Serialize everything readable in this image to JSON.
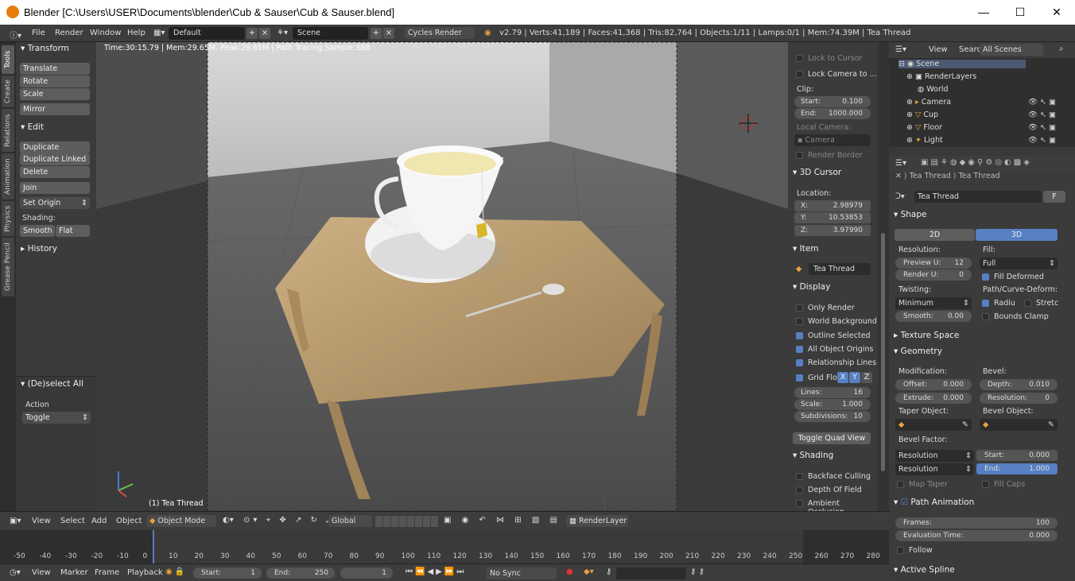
{
  "window": {
    "title": "Blender [C:\\Users\\USER\\Documents\\blender\\Cub & Sauser\\Cub & Sauser.blend]",
    "min": "—",
    "max": "☐",
    "close": "✕"
  },
  "info": {
    "menus": [
      "File",
      "Render",
      "Window",
      "Help"
    ],
    "layout": "Default",
    "scene": "Scene",
    "engine": "Cycles Render",
    "stats": "v2.79 | Verts:41,189 | Faces:41,368 | Tris:82,764 | Objects:1/11 | Lamps:0/1 | Mem:74.39M | Tea Thread"
  },
  "tabs": [
    "Tools",
    "Create",
    "Relations",
    "Animation",
    "Physics",
    "Grease Pencil"
  ],
  "toolshelf": {
    "transform": "Transform",
    "translate": "Translate",
    "rotate": "Rotate",
    "scale": "Scale",
    "mirror": "Mirror",
    "edit": "Edit",
    "duplicate": "Duplicate",
    "duplicate_linked": "Duplicate Linked",
    "delete": "Delete",
    "join": "Join",
    "set_origin": "Set Origin",
    "shading": "Shading:",
    "smooth": "Smooth",
    "flat": "Flat",
    "history": "History",
    "deselect": "(De)select All",
    "action": "Action",
    "toggle": "Toggle"
  },
  "viewport": {
    "status": "Time:30:15.79 | Mem:29.65M, Peak:29.65M | Path Tracing Sample 388",
    "object": "(1) Tea Thread"
  },
  "npanel": {
    "lock_cursor": "Lock to Cursor",
    "lock_camera": "Lock Camera to ...",
    "clip": "Clip:",
    "start_l": "Start:",
    "start_v": "0.100",
    "end_l": "End:",
    "end_v": "1000.000",
    "local_camera": "Local Camera:",
    "camera": "Camera",
    "render_border": "Render Border",
    "cursor": "3D Cursor",
    "location": "Location:",
    "x_l": "X:",
    "x_v": "2.98979",
    "y_l": "Y:",
    "y_v": "10.53853",
    "z_l": "Z:",
    "z_v": "3.97990",
    "item": "Item",
    "item_name": "Tea Thread",
    "display": "Display",
    "only_render": "Only Render",
    "world_bg": "World Background",
    "outline": "Outline Selected",
    "all_origins": "All Object Origins",
    "rel_lines": "Relationship Lines",
    "grid_floor": "Grid Flo",
    "gx": "X",
    "gy": "Y",
    "gz": "Z",
    "lines_l": "Lines:",
    "lines_v": "16",
    "scale_l": "Scale:",
    "scale_v": "1.000",
    "subdiv_l": "Subdivisions:",
    "subdiv_v": "10",
    "quad": "Toggle Quad View",
    "shading": "Shading",
    "backface": "Backface Culling",
    "dof": "Depth Of Field",
    "ao": "Ambient Occlusion"
  },
  "outliner": {
    "view": "View",
    "search": "Search",
    "filter": "All Scenes",
    "items": [
      "Scene",
      "RenderLayers",
      "World",
      "Camera",
      "Cup",
      "Floor",
      "Light"
    ]
  },
  "props": {
    "crumb1": "Tea Thread",
    "crumb2": "Tea Thread",
    "name": "Tea Thread",
    "f": "F",
    "shape": "Shape",
    "d2": "2D",
    "d3": "3D",
    "resolution": "Resolution:",
    "fill": "Fill:",
    "preview_u": "Preview U:",
    "preview_u_v": "12",
    "render_u": "Render U:",
    "render_u_v": "0",
    "fill_v": "Full",
    "fill_deformed": "Fill Deformed",
    "twisting": "Twisting:",
    "path_deform": "Path/Curve-Deform:",
    "twist_v": "Minimum",
    "radius": "Radiu",
    "stretch": "Stretc",
    "smooth_l": "Smooth:",
    "smooth_v": "0.00",
    "bounds": "Bounds Clamp",
    "texture_space": "Texture Space",
    "geometry": "Geometry",
    "modification": "Modification:",
    "bevel": "Bevel:",
    "offset_l": "Offset:",
    "offset_v": "0.000",
    "depth_l": "Depth:",
    "depth_v": "0.010",
    "extrude_l": "Extrude:",
    "extrude_v": "0.000",
    "bres_l": "Resolution:",
    "bres_v": "0",
    "taper": "Taper Object:",
    "bevel_obj": "Bevel Object:",
    "bevel_factor": "Bevel Factor:",
    "res_a": "Resolution",
    "res_b": "Resolution",
    "bstart_l": "Start:",
    "bstart_v": "0.000",
    "bend_l": "End:",
    "bend_v": "1.000",
    "map_taper": "Map Taper",
    "fill_caps": "Fill Caps",
    "path_anim": "Path Animation",
    "frames_l": "Frames:",
    "frames_v": "100",
    "eval_l": "Evaluation Time:",
    "eval_v": "0.000",
    "follow": "Follow",
    "active_spline": "Active Spline"
  },
  "vpheader": {
    "view": "View",
    "select": "Select",
    "add": "Add",
    "object": "Object",
    "mode": "Object Mode",
    "orientation": "Global",
    "layer": "RenderLayer"
  },
  "timeline": {
    "ticks": [
      "-50",
      "-40",
      "-30",
      "-20",
      "-10",
      "0",
      "10",
      "20",
      "30",
      "40",
      "50",
      "60",
      "70",
      "80",
      "90",
      "100",
      "110",
      "120",
      "130",
      "140",
      "150",
      "160",
      "170",
      "180",
      "190",
      "200",
      "210",
      "220",
      "230",
      "240",
      "250",
      "260",
      "270",
      "280"
    ]
  },
  "tlheader": {
    "view": "View",
    "marker": "Marker",
    "frame": "Frame",
    "playback": "Playback",
    "start_l": "Start:",
    "start_v": "1",
    "end_l": "End:",
    "end_v": "250",
    "current": "1",
    "sync": "No Sync"
  }
}
